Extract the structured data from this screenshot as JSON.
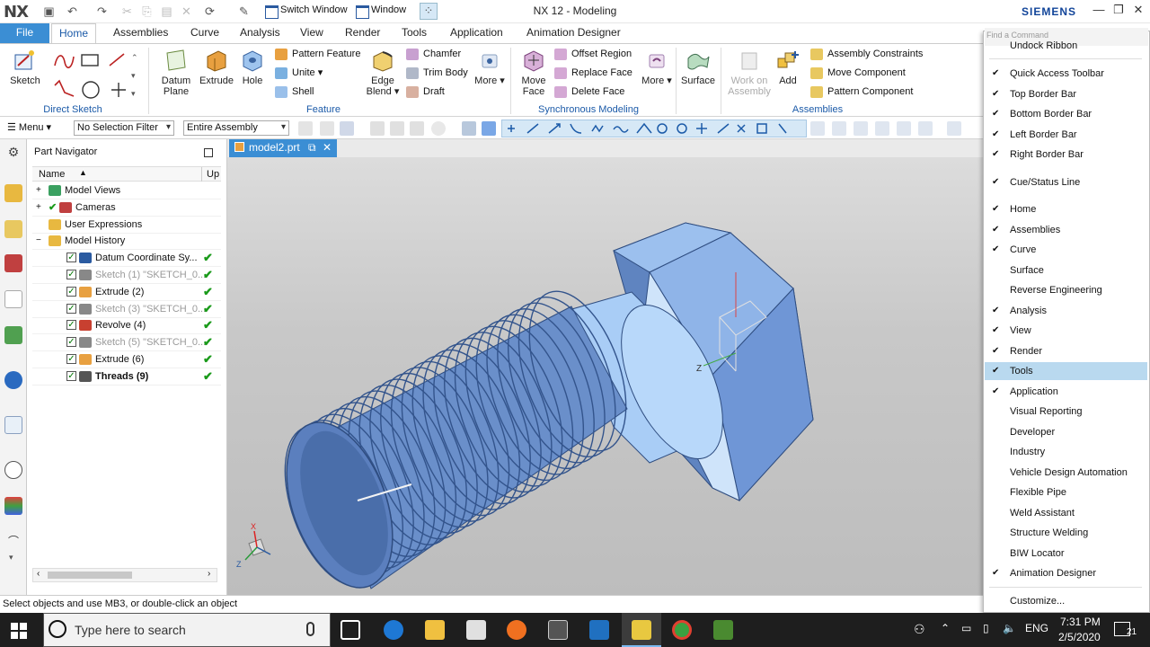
{
  "title_bar": {
    "logo": "NX",
    "switch_window": "Switch Window",
    "window_menu": "Window",
    "title": "NX 12 - Modeling",
    "brand": "SIEMENS",
    "find_placeholder": "Find a Command"
  },
  "tabs": {
    "file": "File",
    "items": [
      "Home",
      "Assemblies",
      "Curve",
      "Analysis",
      "View",
      "Render",
      "Tools",
      "Application",
      "Animation Designer"
    ]
  },
  "ribbon": {
    "sketch": "Sketch",
    "direct_sketch": "Direct Sketch",
    "datum_plane": "Datum Plane",
    "extrude": "Extrude",
    "hole": "Hole",
    "pattern_feature": "Pattern Feature",
    "unite": "Unite",
    "shell": "Shell",
    "edge_blend": "Edge Blend",
    "chamfer": "Chamfer",
    "trim_body": "Trim Body",
    "draft": "Draft",
    "more": "More",
    "feature_group": "Feature",
    "move_face": "Move Face",
    "offset_region": "Offset Region",
    "replace_face": "Replace Face",
    "delete_face": "Delete Face",
    "more2": "More",
    "sync_group": "Synchronous Modeling",
    "surface": "Surface",
    "work_on_assembly": "Work on Assembly",
    "add": "Add",
    "assembly_constraints": "Assembly Constraints",
    "move_component": "Move Component",
    "pattern_component": "Pattern Component",
    "assemblies_group": "Assemblies"
  },
  "selection_bar": {
    "menu": "Menu",
    "filter": "No Selection Filter",
    "scope": "Entire Assembly"
  },
  "part_navigator": {
    "title": "Part Navigator",
    "col_name": "Name",
    "col_up": "Up",
    "rows": [
      {
        "label": "Model Views",
        "indent": 0,
        "expand": "+"
      },
      {
        "label": "Cameras",
        "indent": 0,
        "expand": "+"
      },
      {
        "label": "User Expressions",
        "indent": 0,
        "expand": ""
      },
      {
        "label": "Model History",
        "indent": 0,
        "expand": "−"
      },
      {
        "label": "Datum Coordinate Sy...",
        "indent": 1,
        "ok": "✔",
        "dim": false
      },
      {
        "label": "Sketch (1) \"SKETCH_0...",
        "indent": 1,
        "ok": "✔",
        "dim": true
      },
      {
        "label": "Extrude (2)",
        "indent": 1,
        "ok": "✔",
        "dim": false
      },
      {
        "label": "Sketch (3) \"SKETCH_0...",
        "indent": 1,
        "ok": "✔",
        "dim": true
      },
      {
        "label": "Revolve (4)",
        "indent": 1,
        "ok": "✔",
        "dim": false
      },
      {
        "label": "Sketch (5) \"SKETCH_0...",
        "indent": 1,
        "ok": "✔",
        "dim": true
      },
      {
        "label": "Extrude (6)",
        "indent": 1,
        "ok": "✔",
        "dim": false
      },
      {
        "label": "Threads (9)",
        "indent": 1,
        "ok": "✔",
        "dim": false,
        "bold": true
      }
    ]
  },
  "graphics": {
    "tab": "model2.prt",
    "axis_x": "X",
    "axis_z": "Z",
    "triad_z": "Z"
  },
  "status": "Select objects and use MB3, or double-click an object",
  "context_menu": {
    "undock": "Undock Ribbon",
    "items": [
      {
        "label": "Quick Access Toolbar",
        "checked": true
      },
      {
        "label": "Top Border Bar",
        "checked": true
      },
      {
        "label": "Bottom Border Bar",
        "checked": true
      },
      {
        "label": "Left Border Bar",
        "checked": true
      },
      {
        "label": "Right Border Bar",
        "checked": true
      },
      {
        "label": "Cue/Status Line",
        "checked": true
      },
      {
        "label": "Home",
        "checked": true
      },
      {
        "label": "Assemblies",
        "checked": true
      },
      {
        "label": "Curve",
        "checked": true
      },
      {
        "label": "Surface",
        "checked": false
      },
      {
        "label": "Reverse Engineering",
        "checked": false
      },
      {
        "label": "Analysis",
        "checked": true
      },
      {
        "label": "View",
        "checked": true
      },
      {
        "label": "Render",
        "checked": true
      },
      {
        "label": "Tools",
        "checked": true,
        "highlight": true
      },
      {
        "label": "Application",
        "checked": true
      },
      {
        "label": "Visual Reporting",
        "checked": false
      },
      {
        "label": "Developer",
        "checked": false
      },
      {
        "label": "Industry",
        "checked": false
      },
      {
        "label": "Vehicle Design Automation",
        "checked": false
      },
      {
        "label": "Flexible Pipe",
        "checked": false
      },
      {
        "label": "Weld Assistant",
        "checked": false
      },
      {
        "label": "Structure Welding",
        "checked": false
      },
      {
        "label": "BIW Locator",
        "checked": false
      },
      {
        "label": "Animation Designer",
        "checked": true
      }
    ],
    "customize": "Customize..."
  },
  "taskbar": {
    "search_placeholder": "Type here to search",
    "lang": "ENG",
    "time": "7:31 PM",
    "date": "2/5/2020",
    "notif": "21"
  },
  "colors": {
    "accent": "#3b8ed4",
    "bolt": "#7aa7e6",
    "bolt_dark": "#4d6fa8",
    "check": "#1a9a1a"
  }
}
